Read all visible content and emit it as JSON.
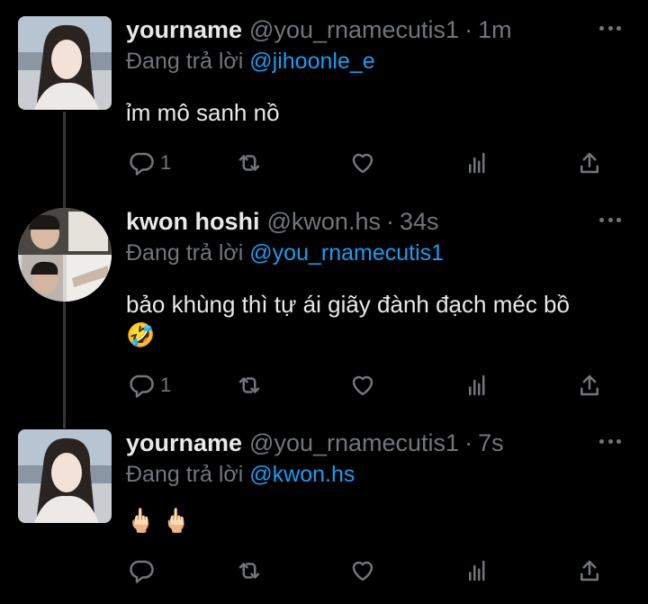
{
  "tweets": [
    {
      "name": "yourname",
      "handle": "@you_rnamecutis1",
      "time": "1m",
      "replying_prefix": "Đang trả lời ",
      "replying_to": "@jihoonle_e",
      "text": "ỉm mô sanh nồ",
      "text2": "",
      "reply_count": "1"
    },
    {
      "name": "kwon hoshi",
      "handle": "@kwon.hs",
      "time": "34s",
      "replying_prefix": "Đang trả lời ",
      "replying_to": "@you_rnamecutis1",
      "text": "bảo khùng thì tự ái giãy đành đạch méc bồ",
      "text2": "🤣",
      "reply_count": "1"
    },
    {
      "name": "yourname",
      "handle": "@you_rnamecutis1",
      "time": "7s",
      "replying_prefix": "Đang trả lời ",
      "replying_to": "@kwon.hs",
      "text": "🖕🏻 🖕🏻",
      "text2": "",
      "reply_count": ""
    }
  ],
  "separator": "·",
  "colors": {
    "background": "#000000",
    "text": "#e7e9ea",
    "muted": "#71767b",
    "link": "#1d9bf0",
    "thread_line": "#333639"
  },
  "icons": [
    "reply-icon",
    "retweet-icon",
    "like-icon",
    "views-icon",
    "share-icon",
    "more-icon"
  ]
}
